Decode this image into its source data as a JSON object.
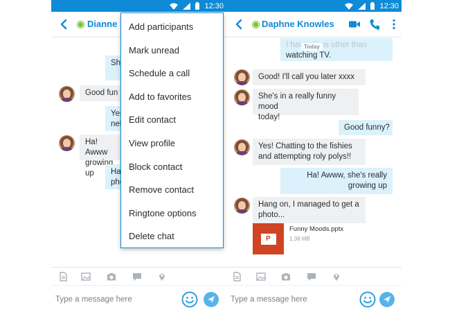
{
  "status_bar": {
    "time": "12:30"
  },
  "left_screen": {
    "contact_name": "Dianne S",
    "bubbles": [
      {
        "dir": "out",
        "text": "She"
      },
      {
        "dir": "in",
        "text": "Good fun"
      },
      {
        "dir": "out",
        "text": "Yes\nnet"
      },
      {
        "dir": "in",
        "text": "Ha! Awww\ngrowing up"
      },
      {
        "dir": "out",
        "text": "Ha\nphe"
      }
    ],
    "composer_placeholder": "Type a message here"
  },
  "overflow_menu": {
    "items": [
      "Add participants",
      "Mark unread",
      "Schedule a call",
      "Add to favorites",
      "Edit contact",
      "View profile",
      "Block contact",
      "Remove contact",
      "Ringtone options",
      "Delete chat"
    ]
  },
  "right_screen": {
    "contact_name": "Daphne Knowles",
    "today_label": "Today",
    "partial_top_text": "I have plans other than",
    "bubbles": [
      {
        "dir": "out",
        "text": "watching TV."
      },
      {
        "dir": "in",
        "text": "Good! I'll call you later xxxx"
      },
      {
        "dir": "in",
        "text": "She's in a really funny mood\ntoday!"
      },
      {
        "dir": "out",
        "text": "Good funny?"
      },
      {
        "dir": "in",
        "text": "Yes! Chatting to the fishies\nand attempting roly polys!!"
      },
      {
        "dir": "out",
        "text": "Ha! Awww, she's really\ngrowing up"
      },
      {
        "dir": "in",
        "text": "Hang on, I managed to get a\nphoto..."
      }
    ],
    "file": {
      "name": "Funny Moods.pptx",
      "size": "1,38 MB",
      "tile_label": "P"
    },
    "composer_placeholder": "Type a message here"
  },
  "colors": {
    "accent": "#0e8ad6",
    "presence_online": "#7cbf2d",
    "incoming_bubble": "#eef0f2",
    "outgoing_bubble": "#dbf2fc",
    "ppt_orange": "#d04423"
  },
  "icons": {
    "status": [
      "wifi-icon",
      "cellular-signal-icon",
      "battery-icon"
    ],
    "appbar_right": [
      "video-call-icon",
      "phone-call-icon",
      "more-options-icon"
    ],
    "toolbar": [
      "file-icon",
      "image-icon",
      "camera-icon",
      "chat-bubble-icon",
      "location-icon"
    ],
    "composer": [
      "emoji-icon",
      "send-icon"
    ]
  }
}
